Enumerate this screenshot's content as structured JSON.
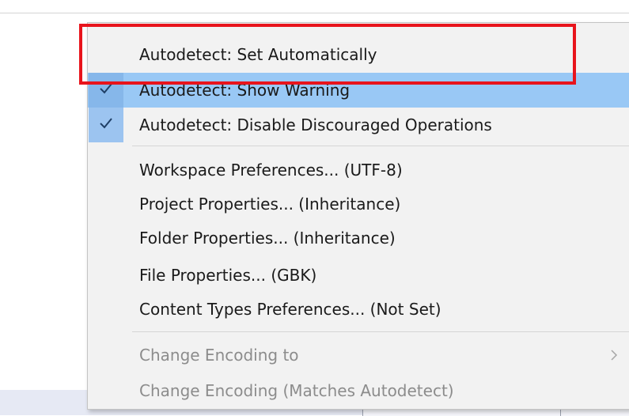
{
  "menu": {
    "items": [
      {
        "label": "Autodetect: Set Automatically",
        "checked": false,
        "highlighted": false,
        "disabled": false,
        "submenu": false
      },
      {
        "label": "Autodetect: Show Warning",
        "checked": true,
        "highlighted": true,
        "disabled": false,
        "submenu": false
      },
      {
        "label": "Autodetect: Disable Discouraged Operations",
        "checked": true,
        "highlighted": false,
        "disabled": false,
        "submenu": false
      },
      {
        "label": "Workspace Preferences... (UTF-8)",
        "checked": false,
        "highlighted": false,
        "disabled": false,
        "submenu": false
      },
      {
        "label": "Project Properties... (Inheritance)",
        "checked": false,
        "highlighted": false,
        "disabled": false,
        "submenu": false
      },
      {
        "label": "Folder Properties... (Inheritance)",
        "checked": false,
        "highlighted": false,
        "disabled": false,
        "submenu": false
      },
      {
        "label": "File Properties... (GBK)",
        "checked": false,
        "highlighted": false,
        "disabled": false,
        "submenu": false
      },
      {
        "label": "Content Types Preferences... (Not Set)",
        "checked": false,
        "highlighted": false,
        "disabled": false,
        "submenu": false
      },
      {
        "label": "Change Encoding to",
        "checked": false,
        "highlighted": false,
        "disabled": true,
        "submenu": true
      },
      {
        "label": "Change Encoding (Matches Autodetect)",
        "checked": false,
        "highlighted": false,
        "disabled": true,
        "submenu": false
      }
    ],
    "icons": {
      "check": "check-icon",
      "submenu": "chevron-right-icon"
    }
  },
  "colors": {
    "highlight": "#99c8f5",
    "check_background": "#9cc4f0",
    "annotation": "#e8141c",
    "disabled_text": "#8c8c8c"
  }
}
